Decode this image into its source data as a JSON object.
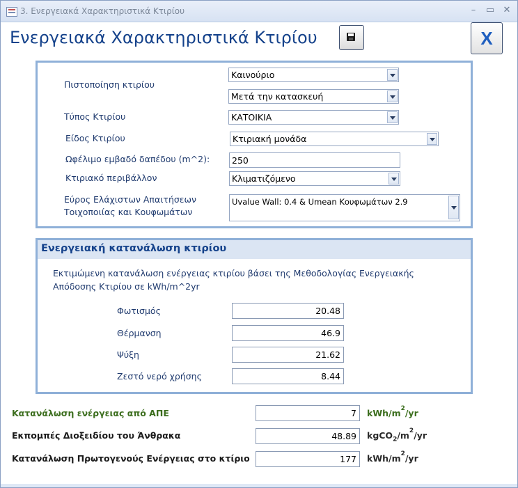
{
  "window": {
    "title": "3. Ενεργειακά Χαρακτηριστικά Κτιρίου",
    "minimize_glyph": "–",
    "restore_glyph": "▭",
    "close_glyph": "✕"
  },
  "header": {
    "title": "Ενεργειακά Χαρακτηριστικά Κτιρίου",
    "close_label": "X"
  },
  "general": {
    "certification_label": "Πιστοποίηση κτιρίου",
    "certification_value_1": "Καινούριο",
    "certification_value_2": "Μετά την κατασκευή",
    "building_type_label": "Τύπος Κτιρίου",
    "building_type_value": "ΚΑΤΟΙΚΙΑ",
    "building_kind_label": "Είδος Κτιρίου",
    "building_kind_value": "Κτιριακή μονάδα",
    "floor_area_label": "Ωφέλιμο εμβαδό δαπέδου (m^2):",
    "floor_area_value": "250",
    "environment_label": "Κτιριακό περιβάλλον",
    "environment_value": "Κλιματιζόμενο",
    "requirements_label_line1": "Εύρος Ελάχιστων Απαιτήσεων",
    "requirements_label_line2": "Τοιχοποιίας και Κουφωμάτων",
    "requirements_value": "Uvalue Wall: 0.4 & Umean Κουφωμάτων 2.9"
  },
  "consumption": {
    "title": "Ενεργειακή κατανάλωση κτιρίου",
    "description": "Εκτιμώμενη κατανάλωση ενέργειας κτιρίου βάσει της Μεθοδολογίας Ενεργειακής Απόδοσης Κτιρίου σε kWh/m^2yr",
    "lighting_label": "Φωτισμός",
    "lighting_value": "20.48",
    "heating_label": "Θέρμανση",
    "heating_value": "46.9",
    "cooling_label": "Ψύξη",
    "cooling_value": "21.62",
    "hot_water_label": "Ζεστό νερό χρήσης",
    "hot_water_value": "8.44"
  },
  "totals": {
    "renewables_label": "Κατανάλωση ενέργειας από ΑΠΕ",
    "renewables_value": "7",
    "renewables_unit_a": "kWh/m",
    "renewables_unit_sup": "2",
    "renewables_unit_b": "/yr",
    "co2_label": "Εκπομπές Διοξειδίου του Άνθρακα",
    "co2_value": "48.89",
    "co2_unit_a": "kgCO",
    "co2_unit_sub": "2",
    "co2_unit_b": "/m",
    "co2_unit_sup": "2",
    "co2_unit_c": "/yr",
    "primary_label": "Κατανάλωση Πρωτογενούς Ενέργειας στο κτίριο",
    "primary_value": "177",
    "primary_unit_a": "kWh/m",
    "primary_unit_sup": "2",
    "primary_unit_b": "/yr"
  },
  "colors": {
    "accent": "#15428b",
    "renewables_label": "#3c6e1e",
    "section_border": "#8fb0d8"
  }
}
